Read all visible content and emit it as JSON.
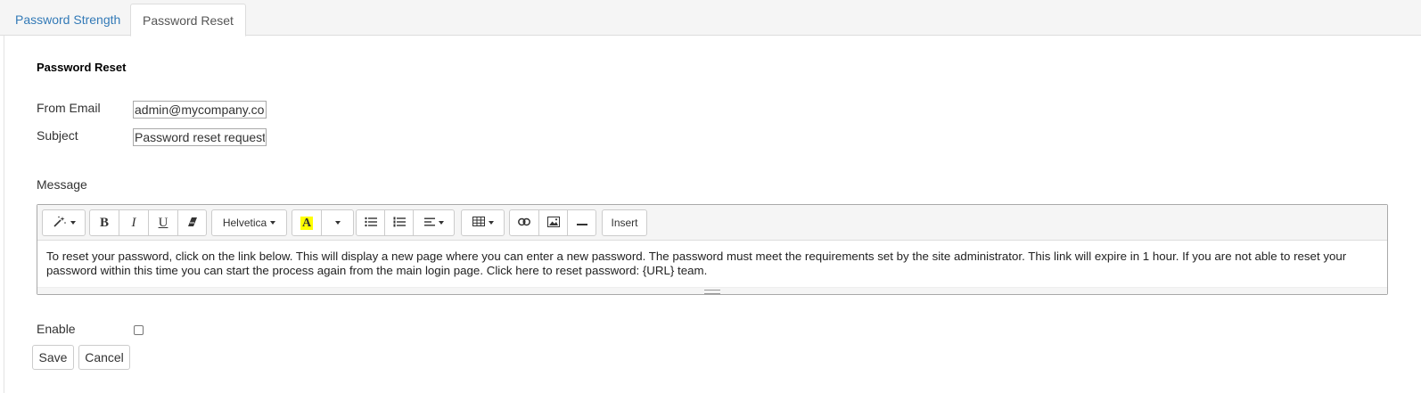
{
  "tabs": [
    {
      "label": "Password Strength",
      "active": false
    },
    {
      "label": "Password Reset",
      "active": true
    }
  ],
  "section_title": "Password Reset",
  "form": {
    "from_email_label": "From Email",
    "from_email_value": "admin@mycompany.com",
    "subject_label": "Subject",
    "subject_value": "Password reset request",
    "message_label": "Message",
    "enable_label": "Enable",
    "enable_checked": false
  },
  "editor": {
    "font_name": "Helvetica",
    "insert_label": "Insert",
    "message_text": "To reset your password, click on the link below. This will display a new page where you can enter a new password. The password must meet the requirements set by the site administrator. This link will expire in 1 hour. If you are not able to reset your password within this time you can start the process again from the main login page. Click here to reset password: {URL} team.",
    "icons": [
      "magic-icon",
      "bold-icon",
      "italic-icon",
      "underline-icon",
      "eraser-icon",
      "highlight-icon",
      "bulleted-list-icon",
      "numbered-list-icon",
      "align-icon",
      "table-icon",
      "link-icon",
      "image-icon",
      "horizontal-rule-icon"
    ]
  },
  "buttons": {
    "save_label": "Save",
    "cancel_label": "Cancel"
  },
  "colors": {
    "link": "#337ab7",
    "highlight": "#ffff00"
  }
}
